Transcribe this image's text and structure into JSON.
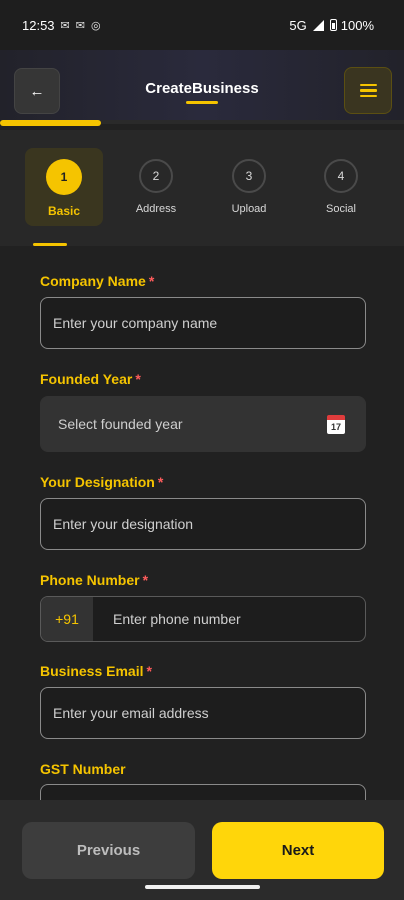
{
  "status_bar": {
    "time": "12:53",
    "left_icons": [
      "gmail-icon",
      "gmail-icon",
      "notification-icon"
    ],
    "network": "5G",
    "battery": "100%"
  },
  "header": {
    "back_icon": "←",
    "title": "CreateBusiness",
    "menu_icon": "hamburger-icon"
  },
  "progress": {
    "fraction": 0.25
  },
  "steps": [
    {
      "number": "1",
      "label": "Basic",
      "active": true
    },
    {
      "number": "2",
      "label": "Address",
      "active": false
    },
    {
      "number": "3",
      "label": "Upload",
      "active": false
    },
    {
      "number": "4",
      "label": "Social",
      "active": false
    }
  ],
  "form": {
    "company_name": {
      "label": "Company Name",
      "required": "*",
      "placeholder": "Enter your company name"
    },
    "founded_year": {
      "label": "Founded Year",
      "required": "*",
      "placeholder": "Select founded year",
      "icon": "calendar-icon",
      "icon_text": "17"
    },
    "designation": {
      "label": "Your Designation",
      "required": "*",
      "placeholder": "Enter your designation"
    },
    "phone": {
      "label": "Phone Number",
      "required": "*",
      "prefix": "+91",
      "placeholder": "Enter phone number"
    },
    "email": {
      "label": "Business Email",
      "required": "*",
      "placeholder": "Enter your email address"
    },
    "gst": {
      "label": "GST Number"
    }
  },
  "footer": {
    "previous_label": "Previous",
    "next_label": "Next"
  },
  "colors": {
    "accent": "#f5c400",
    "next_button": "#ffd60a",
    "background": "#212121",
    "required": "#ff5c5c"
  }
}
